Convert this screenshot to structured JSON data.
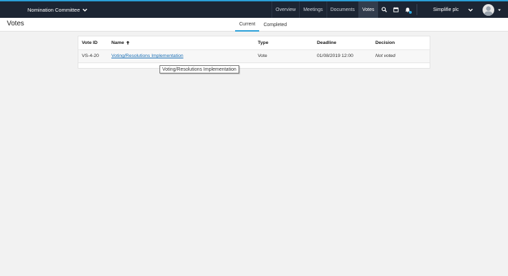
{
  "header": {
    "committee_name": "Nomination Committee",
    "nav": [
      {
        "label": "Overview"
      },
      {
        "label": "Meetings"
      },
      {
        "label": "Documents"
      },
      {
        "label": "Votes",
        "active": true
      }
    ],
    "icons": [
      "search-icon",
      "calendar-icon",
      "bell-icon"
    ],
    "org_name": "Simplifie plc",
    "colors": {
      "topbar": "#1c2533",
      "accent": "#2a9fd8",
      "link": "#1a6fb5"
    }
  },
  "subheader": {
    "title": "Votes",
    "tabs": [
      {
        "label": "Current",
        "active": true
      },
      {
        "label": "Completed"
      }
    ]
  },
  "table": {
    "columns": [
      "Vote ID",
      "Name",
      "Type",
      "Deadline",
      "Decision"
    ],
    "sort": {
      "column": "Name",
      "direction": "asc"
    },
    "rows": [
      {
        "id": "VS-4-20",
        "name": "Voting/Resolutions Implementation",
        "type": "Vote",
        "deadline": "01/08/2019 12:00",
        "decision": "Not voted"
      }
    ]
  },
  "tooltip": {
    "text": "Voting/Resolutions Implementation"
  }
}
